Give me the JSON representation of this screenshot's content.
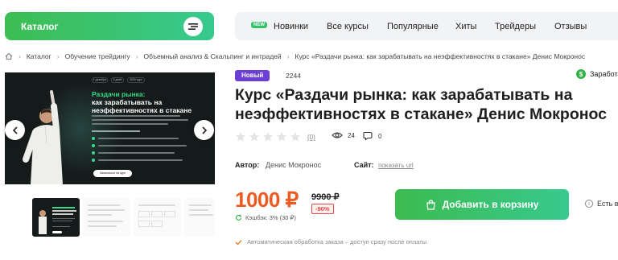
{
  "header": {
    "catalog_label": "Каталог",
    "nav_badge": "NEW",
    "nav_items": [
      "Новинки",
      "Все курсы",
      "Популярные",
      "Хиты",
      "Трейдеры",
      "Отзывы"
    ]
  },
  "breadcrumb": [
    "Каталог",
    "Обучение трейдингу",
    "Объемный анализ & Скальпинг и интрадей",
    "Курс «Раздачи рынка: как зарабатывать на неэффективностях в стакане» Денис Мокронос"
  ],
  "hero": {
    "chips": [
      "1 декабря",
      "5 дней",
      "3000 курс"
    ],
    "title_accent": "Раздачи рынка:",
    "title_rest": "как зарабатывать на неэффективностях в стакане",
    "cta": "Записаться на курс"
  },
  "product": {
    "badge": "Новый",
    "sku": "2244",
    "earn_label": "Заработа",
    "earn_icon": "$",
    "title": "Курс «Раздачи рынка: как зарабатывать на неэффективностях в стакане» Денис Мокронос",
    "rating_count": "(0)",
    "views": "24",
    "comments": "0",
    "author_label": "Автор:",
    "author_value": "Денис Мокронос",
    "site_label": "Сайт:",
    "site_value": "показать url",
    "price": "1000 ₽",
    "old_price": "9900 ₽",
    "discount": "-90%",
    "cashback": "Кэшбэк: 3% (30 ₽)",
    "add_to_cart": "Добавить в корзину",
    "in_stock": "Есть в",
    "auto_note": "Автоматическая обработка заказа – доступ сразу после оплаты."
  },
  "colors": {
    "accent_green": "#37c98e",
    "price_orange": "#ef5a21",
    "badge_purple": "#6b3fd6",
    "discount_red": "#e04a4a"
  },
  "icons": [
    "menu-icon",
    "home-icon",
    "chevron-left-icon",
    "chevron-right-icon",
    "star-icon",
    "eye-icon",
    "comment-icon",
    "dollar-icon",
    "bag-icon",
    "refresh-icon",
    "info-icon",
    "check-icon"
  ]
}
